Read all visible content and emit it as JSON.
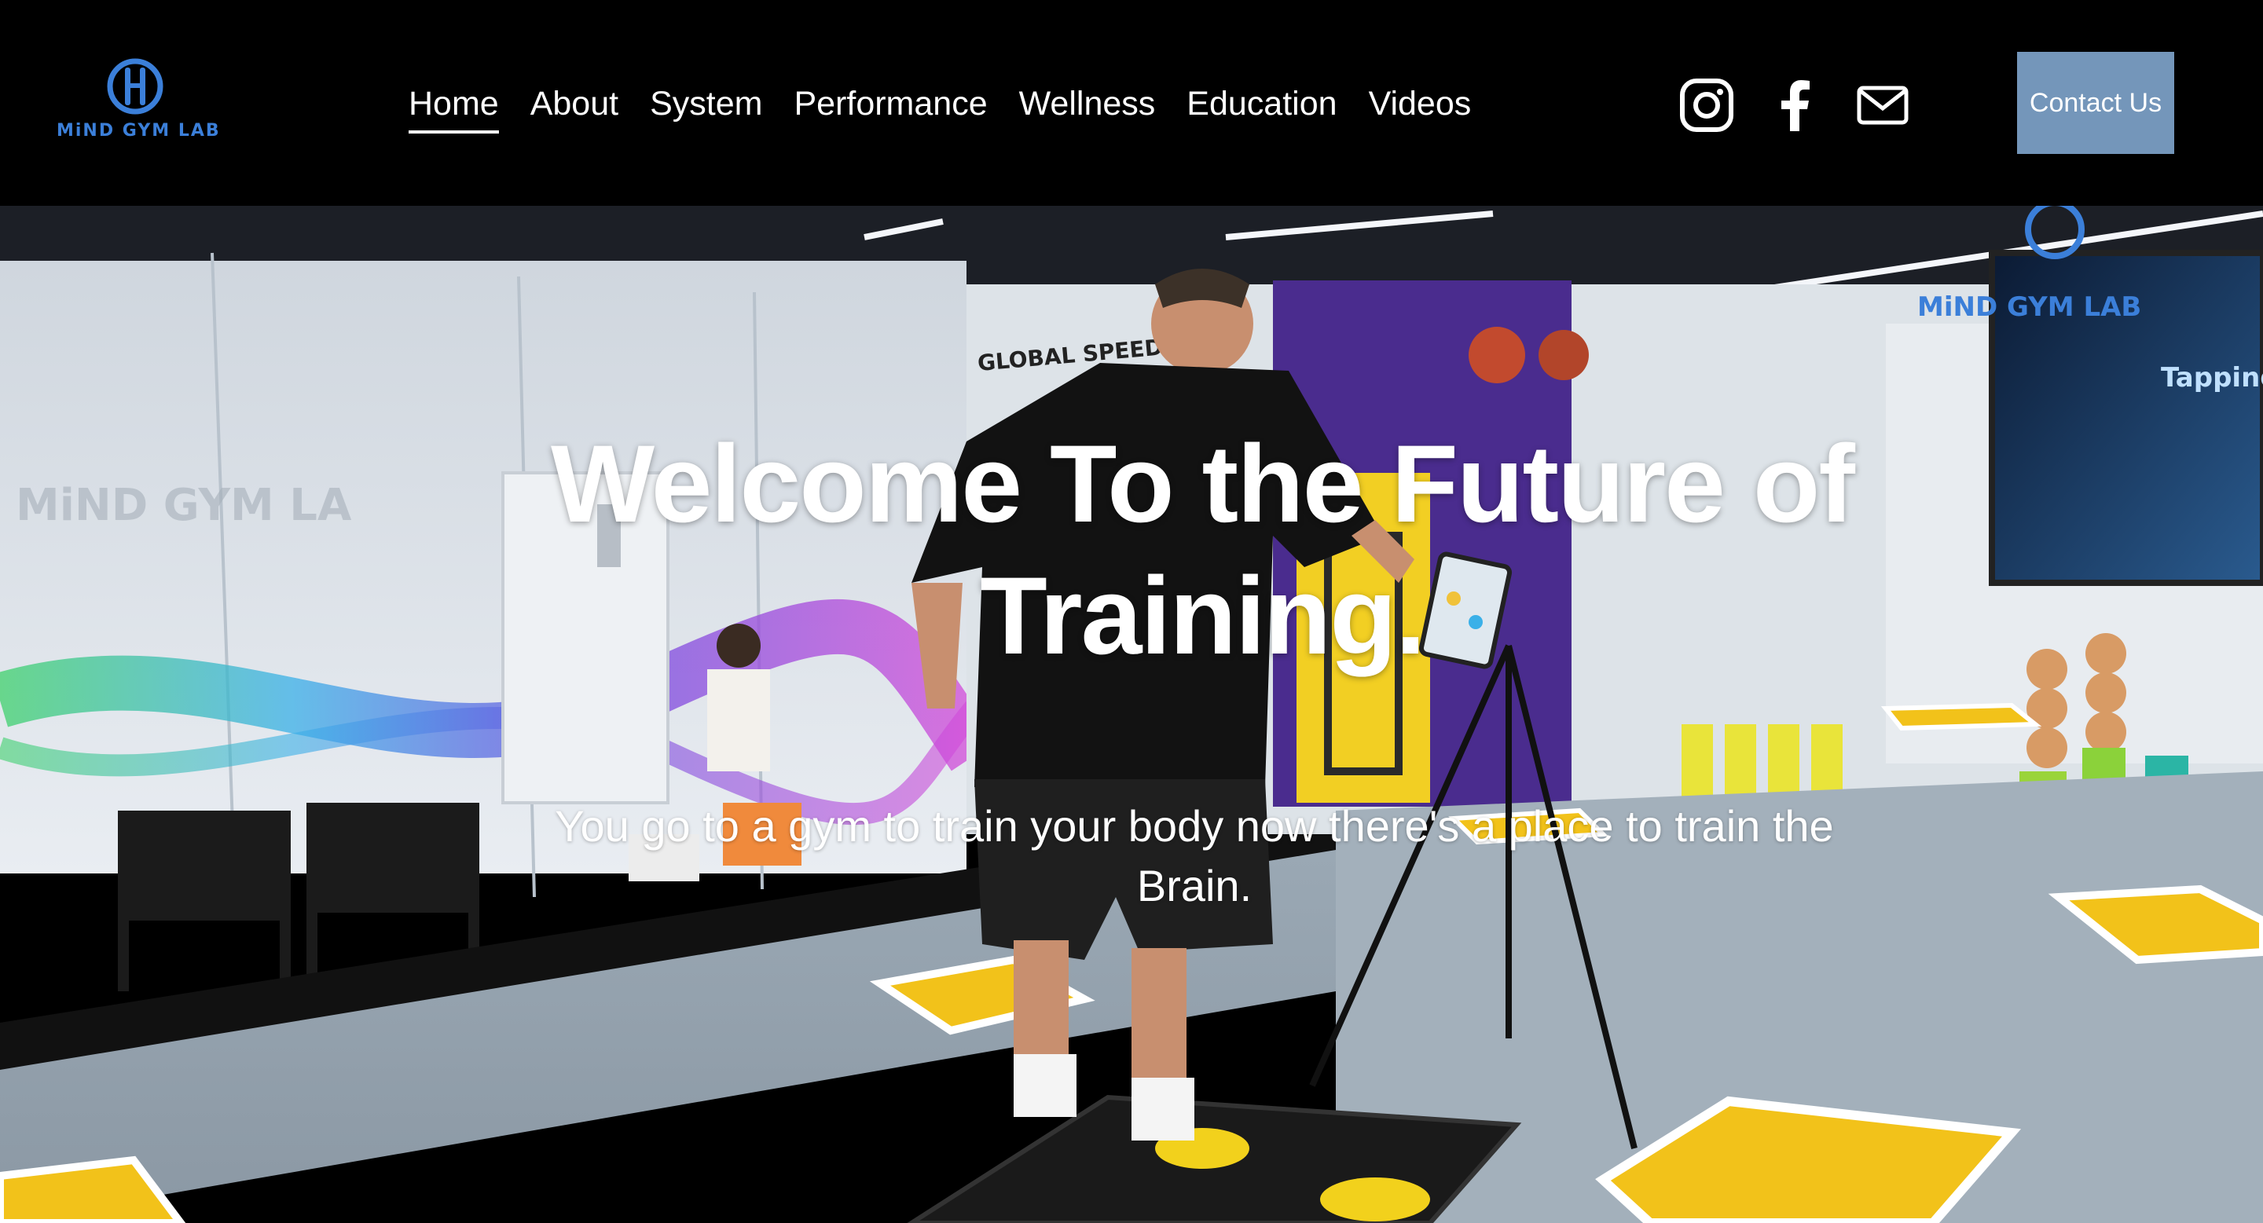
{
  "brand": {
    "logo_text": "MiND GYM LAB",
    "accent": "#3b7fd9"
  },
  "nav": {
    "items": [
      {
        "label": "Home",
        "active": true
      },
      {
        "label": "About"
      },
      {
        "label": "System"
      },
      {
        "label": "Performance"
      },
      {
        "label": "Wellness"
      },
      {
        "label": "Education"
      },
      {
        "label": "Videos"
      }
    ]
  },
  "social": {
    "icons": [
      "instagram-icon",
      "facebook-icon",
      "email-icon"
    ]
  },
  "header": {
    "contact_label": "Contact Us",
    "contact_color": "#7496ba",
    "background": "#000000"
  },
  "hero": {
    "title": "Welcome To the Future of Training.",
    "subtitle": "You go to a gym to train your body now there's a place to train the Brain.",
    "wall_logo": "MiND GYM LAB",
    "screen_text": "Tapping",
    "sign_text": "GLOBAL SPEED"
  }
}
